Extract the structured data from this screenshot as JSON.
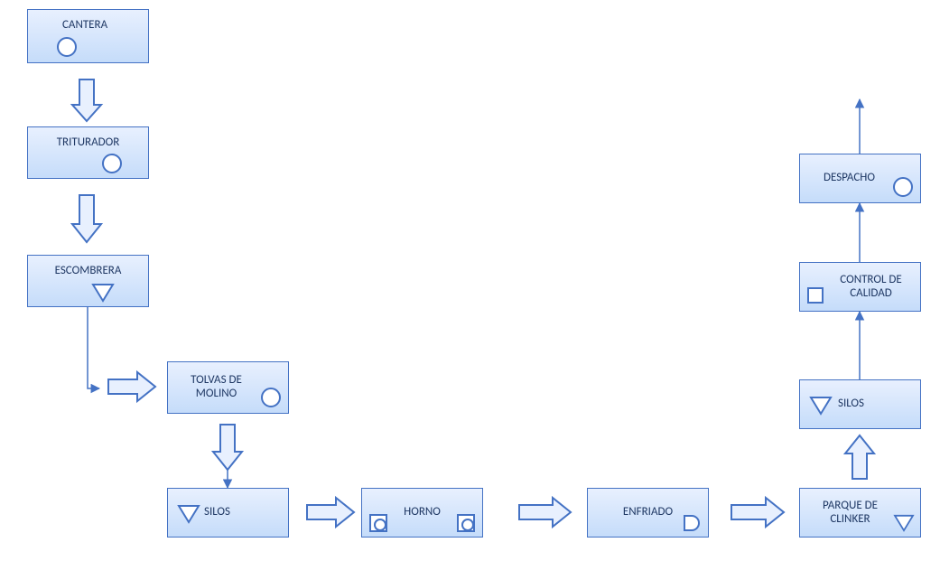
{
  "nodes": {
    "cantera": {
      "label": "CANTERA"
    },
    "triturador": {
      "label": "TRITURADOR"
    },
    "escombrera": {
      "label": "ESCOMBRERA"
    },
    "tolvas": {
      "label": "TOLVAS DE MOLINO"
    },
    "silos1": {
      "label": "SILOS"
    },
    "horno": {
      "label": "HORNO"
    },
    "enfriado": {
      "label": "ENFRIADO"
    },
    "parque": {
      "label": "PARQUE DE CLINKER"
    },
    "silos2": {
      "label": "SILOS"
    },
    "control": {
      "label": "CONTROL DE CALIDAD"
    },
    "despacho": {
      "label": "DESPACHO"
    }
  },
  "flow_sequence": [
    "cantera",
    "triturador",
    "escombrera",
    "tolvas",
    "silos1",
    "horno",
    "enfriado",
    "parque",
    "silos2",
    "control",
    "despacho"
  ],
  "colors": {
    "border": "#4472C4",
    "fill_top": "#E8F0FE",
    "fill_bottom": "#C5DCFA",
    "text": "#1F3864"
  }
}
